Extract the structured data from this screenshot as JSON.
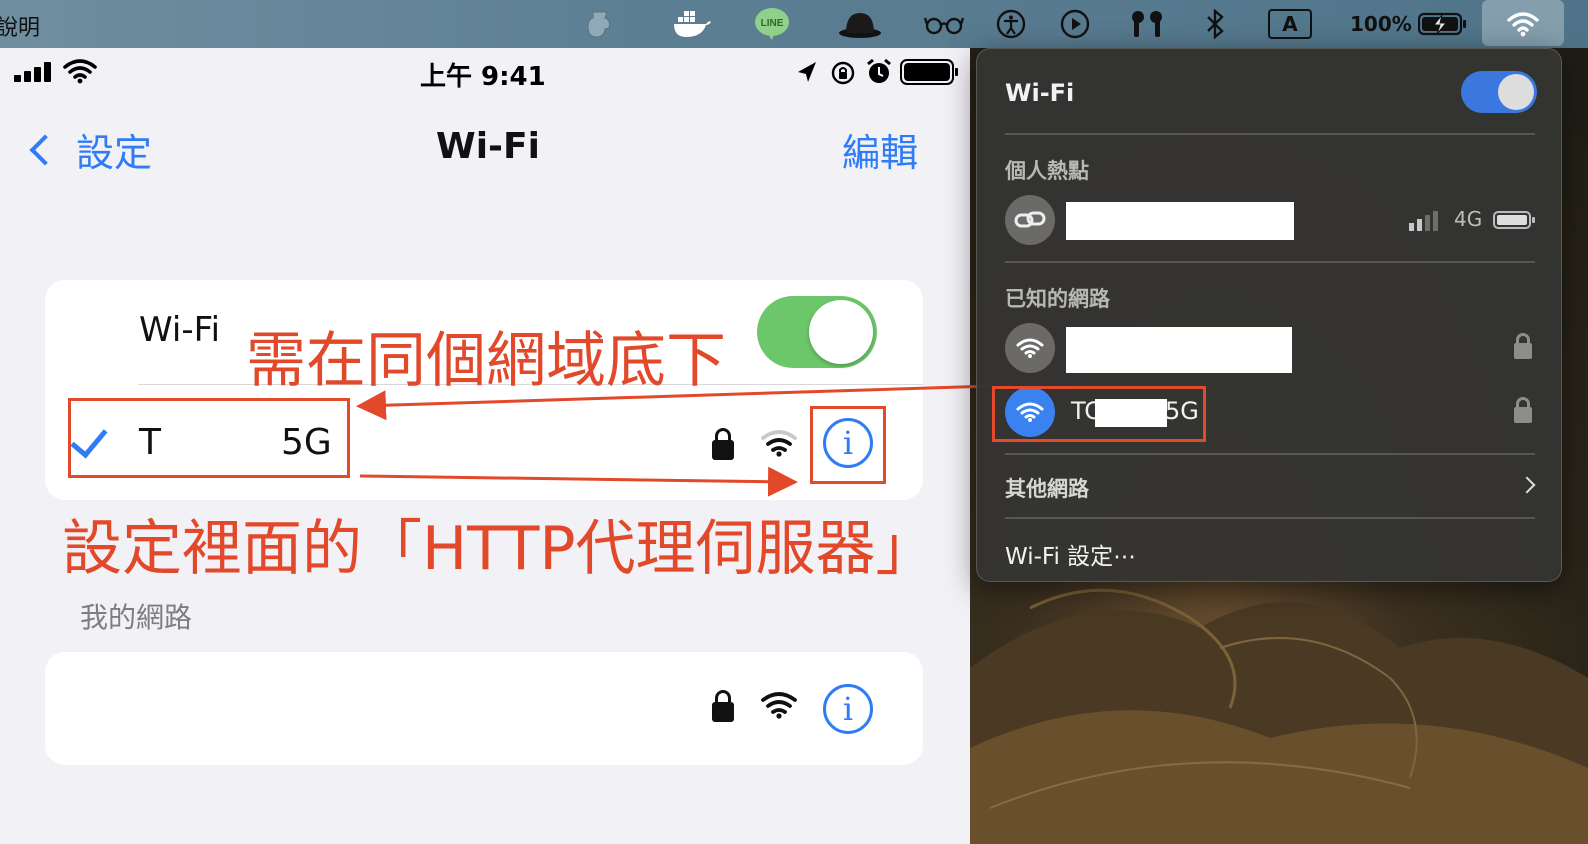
{
  "menubar": {
    "app_menu": "說明",
    "battery_percent": "100%",
    "input_method": "A",
    "icons": [
      "pitcher-icon",
      "docker-icon",
      "line-icon",
      "bowler-hat-icon",
      "glasses-icon",
      "accessibility-icon",
      "play-icon",
      "airpods-icon",
      "bluetooth-icon",
      "input-source-icon",
      "battery-charging-icon",
      "wifi-icon"
    ],
    "line_label": "LINE"
  },
  "phone": {
    "time": "上午 9:41",
    "nav": {
      "back_label": "設定",
      "title": "Wi-Fi",
      "edit_label": "編輯"
    },
    "wifi_row_label": "Wi-Fi",
    "wifi_enabled": true,
    "current_network": {
      "ssid_start": "T",
      "ssid_end": "5G"
    },
    "section_header": "我的網路",
    "accent_color": "#2f7cf6",
    "toggle_color": "#6cc76a"
  },
  "annotations": {
    "same_network": "需在同個網域底下",
    "proxy_setting": "設定裡面的「HTTP代理伺服器」",
    "color": "#e2482a"
  },
  "mac_wifi_menu": {
    "title": "Wi-Fi",
    "wifi_enabled": true,
    "hotspot_header": "個人熱點",
    "hotspot_signal": "4G",
    "known_header": "已知的網路",
    "known_network_2": {
      "ssid_start": "TC",
      "ssid_end": "5G"
    },
    "other_networks": "其他網路",
    "wifi_settings": "Wi-Fi 設定⋯"
  }
}
